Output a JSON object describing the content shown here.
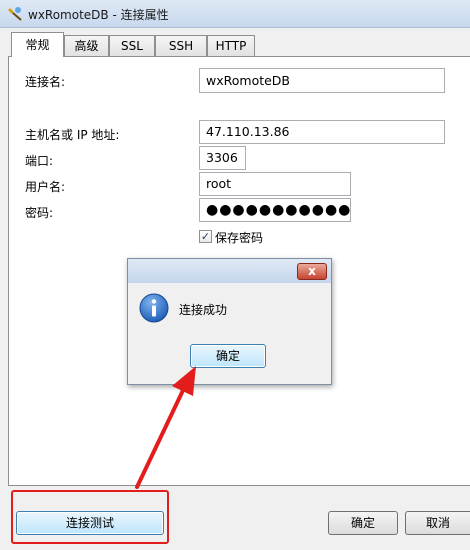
{
  "window": {
    "title": "wxRomoteDB - 连接属性"
  },
  "tabs": [
    {
      "label": "常规",
      "active": true
    },
    {
      "label": "高级",
      "active": false
    },
    {
      "label": "SSL",
      "active": false
    },
    {
      "label": "SSH",
      "active": false
    },
    {
      "label": "HTTP",
      "active": false
    }
  ],
  "form": {
    "connection_name_label": "连接名:",
    "connection_name_value": "wxRomoteDB",
    "host_label": "主机名或 IP 地址:",
    "host_value": "47.110.13.86",
    "port_label": "端口:",
    "port_value": "3306",
    "user_label": "用户名:",
    "user_value": "root",
    "password_label": "密码:",
    "password_value": "●●●●●●●●●●●●●",
    "save_password_label": "保存密码",
    "save_password_checked": true
  },
  "dialog": {
    "message": "连接成功",
    "ok_label": "确定",
    "close_glyph": "x",
    "icon": "info-icon"
  },
  "buttons": {
    "test_connection": "连接测试",
    "ok": "确定",
    "cancel": "取消"
  },
  "colors": {
    "annotation": "#e31c1c",
    "info_icon": "#1f5fb8"
  }
}
